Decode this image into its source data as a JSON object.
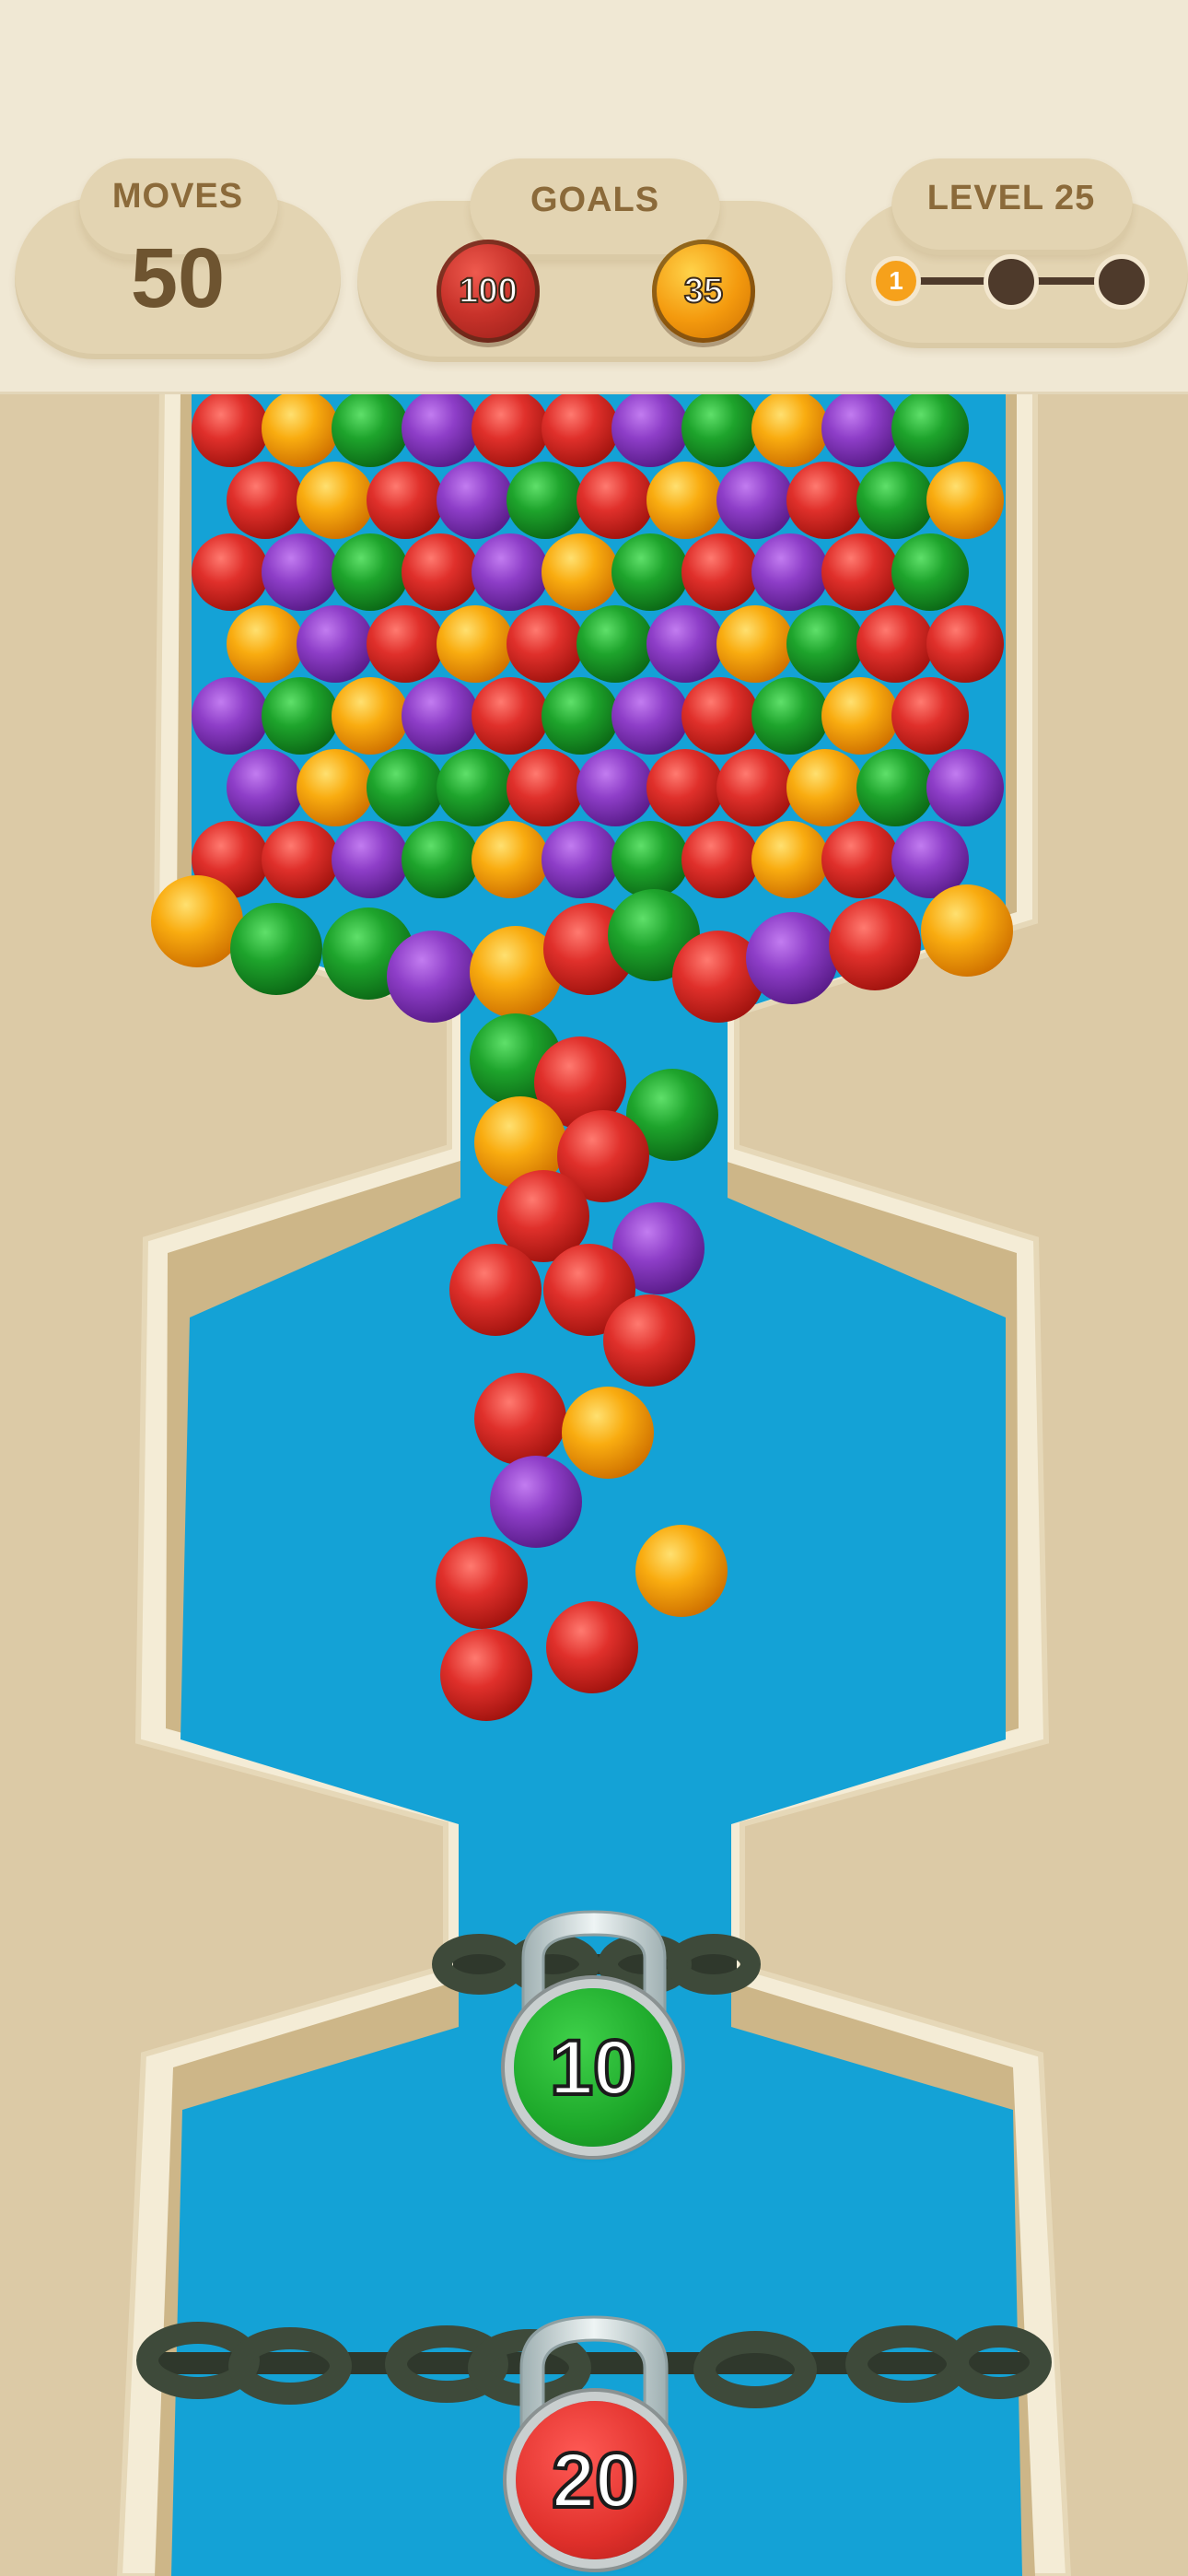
{
  "hud": {
    "moves": {
      "label": "MOVES",
      "value": "50"
    },
    "goals": {
      "label": "GOALS",
      "items": [
        {
          "count": "100",
          "color": "red"
        },
        {
          "count": "35",
          "color": "orange"
        }
      ]
    },
    "level": {
      "label": "LEVEL 25",
      "current_stage": "1",
      "stages_total": 3
    }
  },
  "board": {
    "locks": [
      {
        "count": "10",
        "color": "green"
      },
      {
        "count": "20",
        "color": "red"
      }
    ]
  },
  "colors": {
    "water": "#14a2d6",
    "wall": "#f3ebd5",
    "ground": "#dccaa6",
    "red": "#e02a2a",
    "orange": "#f9a80a",
    "green": "#1aa02a",
    "purple": "#8e3ec8"
  }
}
